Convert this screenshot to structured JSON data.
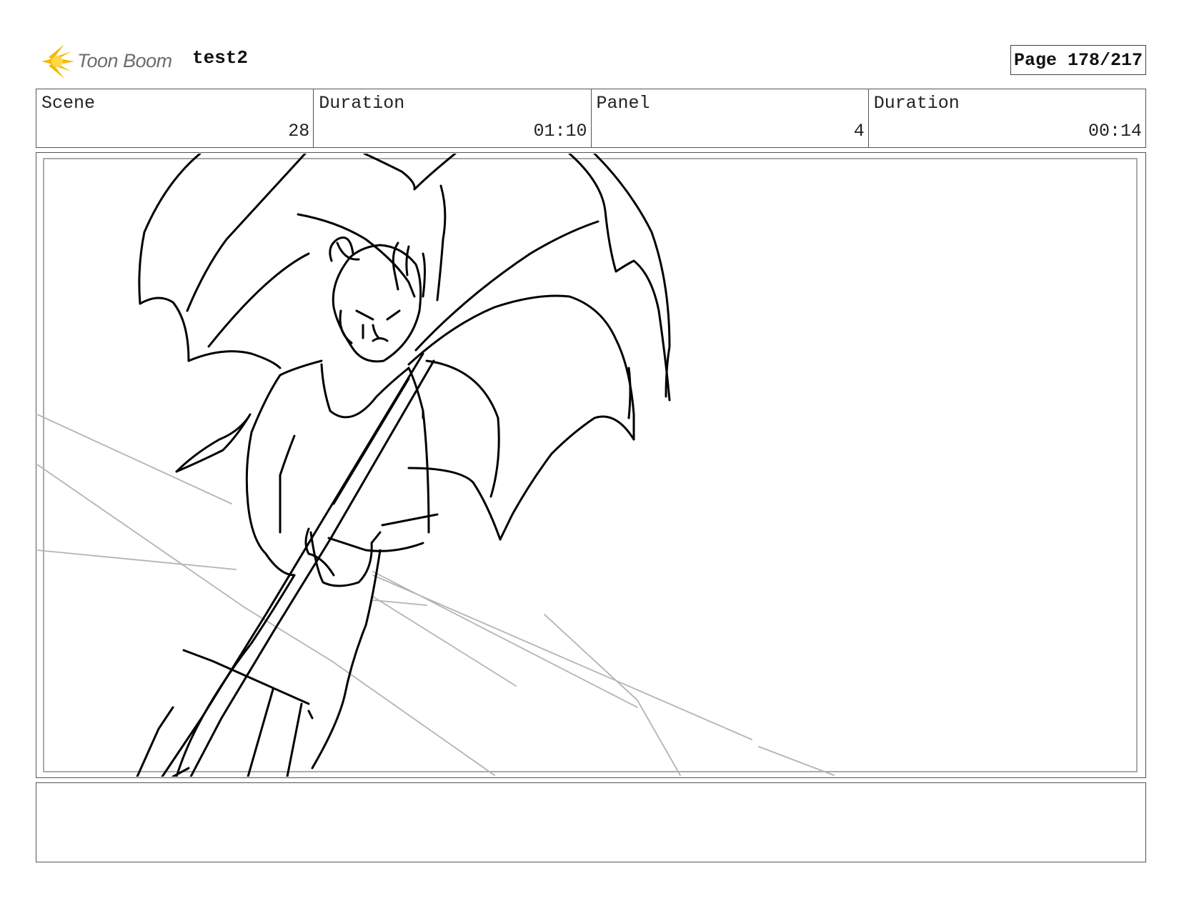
{
  "header": {
    "brand": "Toon Boom",
    "brand_color": "#f5b800",
    "project_title": "test2",
    "page_label": "Page 178/217"
  },
  "info": {
    "scene_label": "Scene",
    "scene_value": "28",
    "scene_duration_label": "Duration",
    "scene_duration_value": "01:10",
    "panel_label": "Panel",
    "panel_value": "4",
    "panel_duration_label": "Duration",
    "panel_duration_value": "00:14"
  },
  "panel": {
    "drawing": "storyboard sketch of a girl holding a bat-wing umbrella"
  },
  "notes": {
    "text": ""
  }
}
